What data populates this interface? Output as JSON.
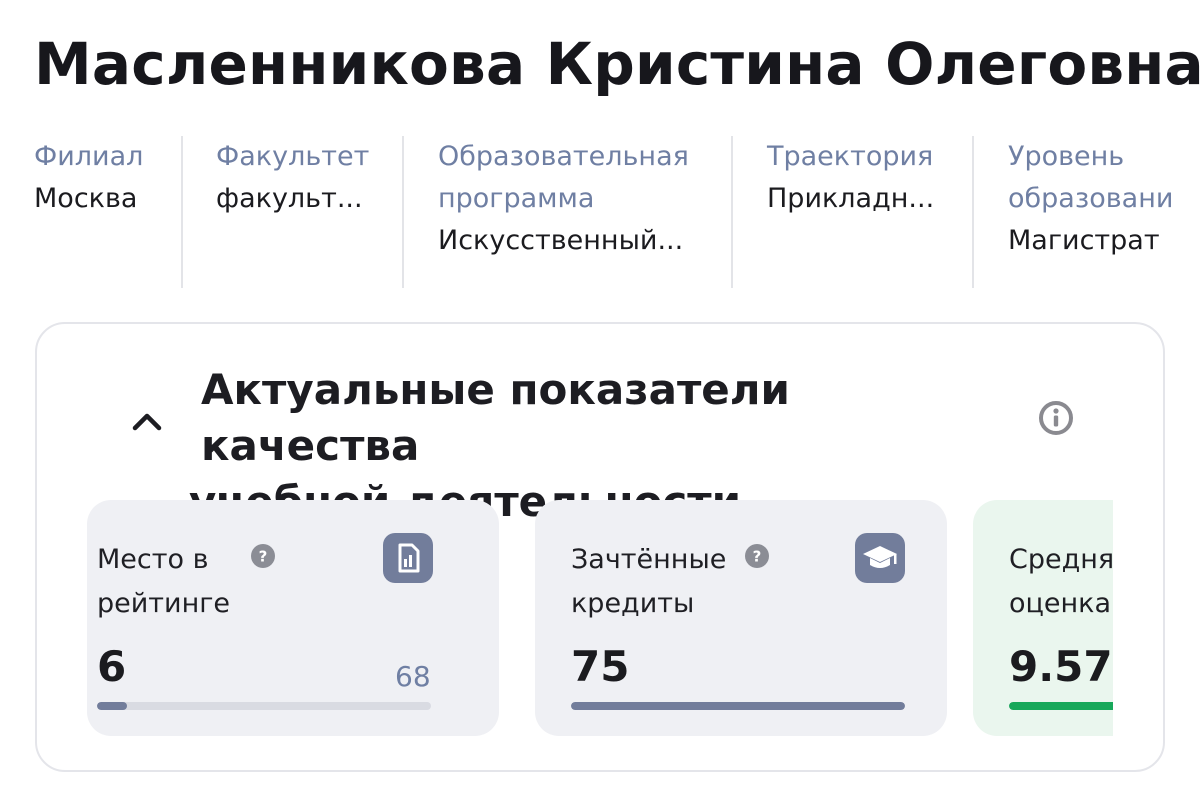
{
  "student": {
    "name": "Масленникова Кристина Олеговна"
  },
  "info": [
    {
      "label": "Филиал",
      "value": "Москва"
    },
    {
      "label": "Факультет",
      "value": "факульт..."
    },
    {
      "label_line1": "Образовательная",
      "label_line2": "программа",
      "value": "Искусственный..."
    },
    {
      "label": "Траектория",
      "value": "Прикладн..."
    },
    {
      "label_line1": "Уровень",
      "label_line2": "образовани",
      "value": "Магистрат"
    }
  ],
  "quality_panel": {
    "title_line1": "Актуальные показатели качества",
    "title_line2": "учебной деятельности",
    "expand_icon": "chevron-up-icon",
    "info_icon": "info-circle-icon"
  },
  "cards": [
    {
      "title_line1": "Место в",
      "title_line2": "рейтинге",
      "value": "6",
      "total": "68",
      "progress": 0.09,
      "bar_color": "#727d9b",
      "icon": "rating-document-icon"
    },
    {
      "title_line1": "Зачтённые",
      "title_line2": "кредиты",
      "value": "75",
      "progress": 1.0,
      "bar_color": "#727d9b",
      "icon": "graduation-cap-icon"
    },
    {
      "title_line1": "Средняя",
      "title_line2": "оценка",
      "value": "9.57",
      "progress": 1.0,
      "bar_color": "#17a85a"
    }
  ],
  "colors": {
    "accent": "#727d9b",
    "label": "#6f7fa3",
    "success": "#17a85a"
  }
}
